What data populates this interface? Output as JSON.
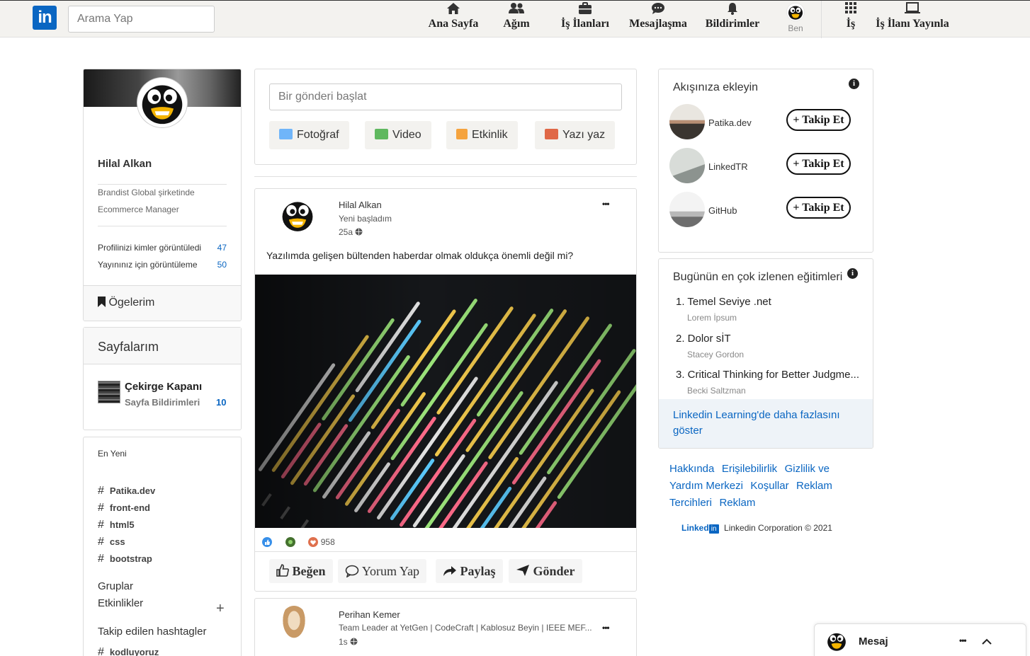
{
  "brand": {
    "logo_text": "in",
    "accent": "#0a66c2"
  },
  "search": {
    "placeholder": "Arama Yap"
  },
  "nav": {
    "home": "Ana Sayfa",
    "network": "Ağım",
    "jobs": "İş İlanları",
    "messaging": "Mesajlaşma",
    "notifications": "Bildirimler",
    "me": "Ben",
    "work": "İş",
    "post_job": "İş İlanı Yayınla"
  },
  "profile": {
    "name": "Hilal Alkan",
    "title_line1": "Brandist Global şirketinde",
    "title_line2": "Ecommerce Manager",
    "stats": [
      {
        "label": "Profilinizi kimler görüntüledi",
        "value": "47"
      },
      {
        "label": "Yayınınız için görüntüleme",
        "value": "50"
      }
    ],
    "items_label": "Ögelerim"
  },
  "pages": {
    "title": "Sayfalarım",
    "page_name": "Çekirge Kapanı",
    "page_sub": "Sayfa Bildirimleri",
    "page_count": "10"
  },
  "recent": {
    "title": "En Yeni",
    "tags": [
      "Patika.dev",
      "front-end",
      "html5",
      "css",
      "bootstrap"
    ],
    "groups": "Gruplar",
    "events": "Etkinlikler",
    "plus": "+",
    "followed_title": "Takip edilen hashtagler",
    "followed_tags": [
      "kodluyoruz"
    ],
    "hash": "#"
  },
  "composer": {
    "placeholder": "Bir gönderi başlat",
    "buttons": {
      "photo": "Fotoğraf",
      "video": "Video",
      "event": "Etkinlik",
      "article": "Yazı yaz"
    }
  },
  "post1": {
    "author": "Hilal Alkan",
    "subtitle": "Yeni başladım",
    "time": "25a",
    "more": "•••",
    "text": "Yazılımda gelişen bültenden haberdar olmak oldukça önemli değil mi?",
    "reactions_count": "958",
    "actions": {
      "like": "Beğen",
      "comment": "Yorum Yap",
      "share": "Paylaş",
      "send": "Gönder"
    }
  },
  "post2": {
    "author": "Perihan Kemer",
    "subtitle": "Team Leader at YetGen | CodeCraft | Kablosuz Beyin | IEEE MEF...",
    "time": "1s",
    "more": "•••"
  },
  "feed_suggest": {
    "title": "Akışınıza ekleyin",
    "info": "i",
    "items": [
      {
        "name": "Patika.dev",
        "button": "+ Takip Et"
      },
      {
        "name": "LinkedTR",
        "button": "+ Takip Et"
      },
      {
        "name": "GitHub",
        "button": "+ Takip Et"
      }
    ]
  },
  "courses": {
    "title": "Bugünün en çok izlenen eğitimleri",
    "info": "i",
    "items": [
      {
        "title": "1. Temel Seviye .net",
        "author": "Lorem İpsum"
      },
      {
        "title": "2. Dolor sİT",
        "author": "Stacey Gordon"
      },
      {
        "title": "3. Critical Thinking for Better Judgme...",
        "author": "Becki Saltzman"
      }
    ],
    "more": "Linkedin Learning'de daha fazlasını göster"
  },
  "footer": {
    "links": [
      "Hakkında",
      "Erişilebilirlik",
      "Gizlilik ve",
      "Yardım Merkezi",
      "Koşullar",
      "Reklam Tercihleri",
      "Reklam"
    ],
    "brand_word": "Linked",
    "brand_in": "in",
    "copyright": "Linkedin Corporation © 2021"
  },
  "messaging": {
    "title": "Mesaj",
    "more": "•••",
    "toggle": "⌃"
  }
}
